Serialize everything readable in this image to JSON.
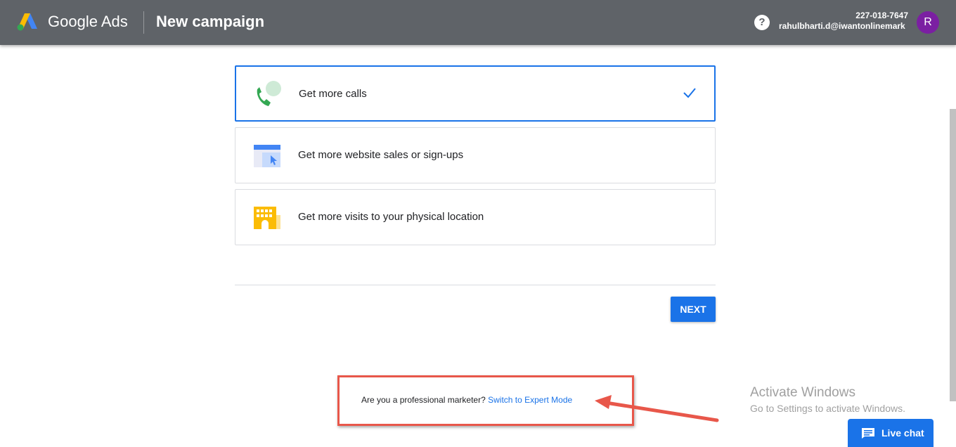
{
  "header": {
    "brand": "Google Ads",
    "title": "New campaign",
    "help_glyph": "?",
    "account_id": "227-018-7647",
    "account_email": "rahulbharti.d@iwantonlinemark...",
    "avatar_letter": "R"
  },
  "goals": [
    {
      "label": "Get more calls",
      "icon": "phone-call-icon",
      "selected": true
    },
    {
      "label": "Get more website sales or sign-ups",
      "icon": "website-cursor-icon",
      "selected": false
    },
    {
      "label": "Get more visits to your physical location",
      "icon": "storefront-icon",
      "selected": false
    }
  ],
  "actions": {
    "next_label": "NEXT"
  },
  "expert_mode": {
    "question": "Are you a professional marketer?",
    "link": "Switch to Expert Mode"
  },
  "watermark": {
    "line1": "Activate Windows",
    "line2": "Go to Settings to activate Windows."
  },
  "live_chat": {
    "label": "Live chat"
  },
  "colors": {
    "header": "#5f6368",
    "accent": "#1a73e8",
    "annotation": "#e8574a"
  }
}
